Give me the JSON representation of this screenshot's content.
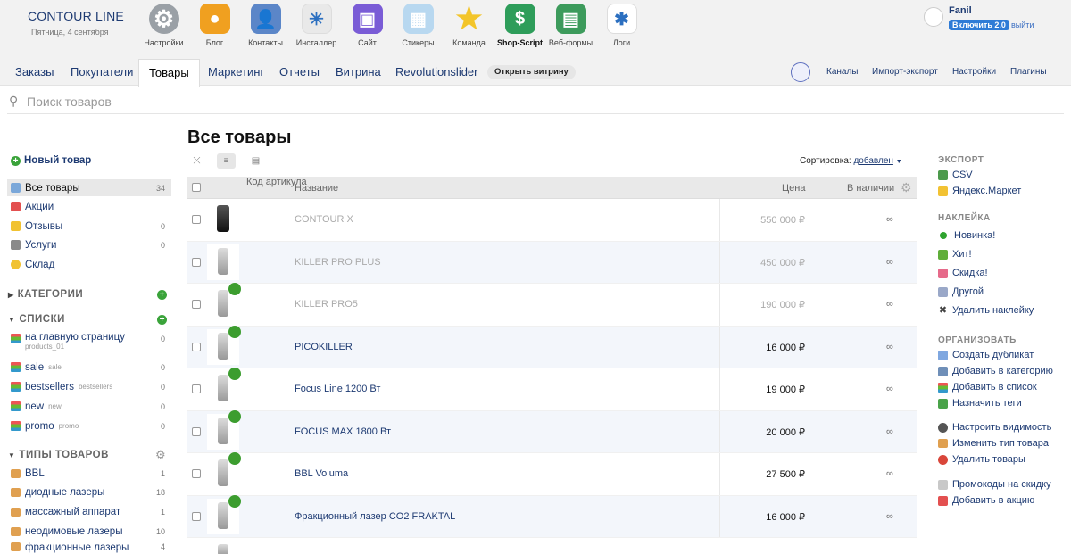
{
  "brand": {
    "name": "CONTOUR LINE",
    "date": "Пятница, 4 сентября"
  },
  "apps": [
    {
      "label": "Настройки",
      "icon": "settings-gear-icon",
      "glyph": "⚙",
      "color": "#9aa0a6"
    },
    {
      "label": "Блог",
      "icon": "blog-icon",
      "glyph": "●",
      "color": "#f0a020"
    },
    {
      "label": "Контакты",
      "icon": "contacts-icon",
      "glyph": "👤",
      "color": "#5b86c8"
    },
    {
      "label": "Инсталлер",
      "icon": "installer-icon",
      "glyph": "✳",
      "color": "#e9e9e9"
    },
    {
      "label": "Сайт",
      "icon": "site-icon",
      "glyph": "▣",
      "color": "#7a5cd6"
    },
    {
      "label": "Стикеры",
      "icon": "stickers-icon",
      "glyph": "▦",
      "color": "#b8d8f0"
    },
    {
      "label": "Команда",
      "icon": "team-star-icon",
      "glyph": "★",
      "color": "transparent"
    },
    {
      "label": "Shop-Script",
      "icon": "shop-script-icon",
      "glyph": "$",
      "color": "#2e9d5a"
    },
    {
      "label": "Веб-формы",
      "icon": "webforms-icon",
      "glyph": "▤",
      "color": "#3d9b5c"
    },
    {
      "label": "Логи",
      "icon": "logs-icon",
      "glyph": "✱",
      "color": "#ffffff"
    }
  ],
  "user": {
    "name": "Fanil",
    "upgrade": "Включить 2.0",
    "logout": "выйти"
  },
  "nav": {
    "tabs": [
      "Заказы",
      "Покупатели",
      "Товары",
      "Маркетинг",
      "Отчеты",
      "Витрина",
      "Revolutionslider"
    ],
    "open_store": "Открыть витрину",
    "right": [
      "Каналы",
      "Импорт-экспорт",
      "Настройки",
      "Плагины"
    ]
  },
  "search": {
    "placeholder": "Поиск товаров"
  },
  "sidebar": {
    "new_product": "Новый товар",
    "main_items": [
      {
        "label": "Все товары",
        "count": "34"
      },
      {
        "label": "Акции",
        "count": ""
      },
      {
        "label": "Отзывы",
        "count": "0"
      },
      {
        "label": "Услуги",
        "count": "0"
      },
      {
        "label": "Склад",
        "count": ""
      }
    ],
    "categories_title": "КАТЕГОРИИ",
    "lists_title": "СПИСКИ",
    "lists": [
      {
        "label": "на главную страницу",
        "sub": "products_01",
        "count": "0"
      },
      {
        "label": "sale",
        "sub": "sale",
        "count": "0"
      },
      {
        "label": "bestsellers",
        "sub": "bestsellers",
        "count": "0"
      },
      {
        "label": "new",
        "sub": "new",
        "count": "0"
      },
      {
        "label": "promo",
        "sub": "promo",
        "count": "0"
      }
    ],
    "types_title": "ТИПЫ ТОВАРОВ",
    "types": [
      {
        "label": "BBL",
        "count": "1"
      },
      {
        "label": "диодные лазеры",
        "count": "18"
      },
      {
        "label": "массажный аппарат",
        "count": "1"
      },
      {
        "label": "неодимовые лазеры",
        "count": "10"
      },
      {
        "label": "фракционные лазеры",
        "count": "4"
      }
    ]
  },
  "main": {
    "title": "Все товары",
    "sort_label": "Сортировка:",
    "sort_value": "добавлен",
    "headers": {
      "sku": "Код артикула",
      "name": "Название",
      "price": "Цена",
      "stock": "В наличии"
    },
    "products": [
      {
        "name": "CONTOUR X",
        "price": "550 000 ₽",
        "stock": "∞",
        "active": false,
        "badge": false
      },
      {
        "name": "KILLER PRO PLUS",
        "price": "450 000 ₽",
        "stock": "∞",
        "active": false,
        "badge": false
      },
      {
        "name": "KILLER PRO5",
        "price": "190 000 ₽",
        "stock": "∞",
        "active": false,
        "badge": true
      },
      {
        "name": "PICOKILLER",
        "price": "16 000 ₽",
        "stock": "∞",
        "active": true,
        "badge": true
      },
      {
        "name": "Focus Line 1200 Вт",
        "price": "19 000 ₽",
        "stock": "∞",
        "active": true,
        "badge": true
      },
      {
        "name": "FOCUS MAX 1800 Вт",
        "price": "20 000 ₽",
        "stock": "∞",
        "active": true,
        "badge": true
      },
      {
        "name": "BBL Voluma",
        "price": "27 500 ₽",
        "stock": "∞",
        "active": true,
        "badge": true
      },
      {
        "name": "Фракционный лазер CO2 FRAKTAL",
        "price": "16 000 ₽",
        "stock": "∞",
        "active": true,
        "badge": true
      }
    ]
  },
  "right_panel": {
    "export_title": "ЭКСПОРТ",
    "export": [
      "CSV",
      "Яндекс.Маркет"
    ],
    "labels_title": "НАКЛЕЙКА",
    "labels": [
      "Новинка!",
      "Хит!",
      "Скидка!",
      "Другой",
      "Удалить наклейку"
    ],
    "organize_title": "ОРГАНИЗОВАТЬ",
    "organize": [
      "Создать дубликат",
      "Добавить в категорию",
      "Добавить в список",
      "Назначить теги"
    ],
    "visibility": [
      "Настроить видимость",
      "Изменить тип товара",
      "Удалить товары"
    ],
    "promo": [
      "Промокоды на скидку",
      "Добавить в акцию"
    ]
  }
}
